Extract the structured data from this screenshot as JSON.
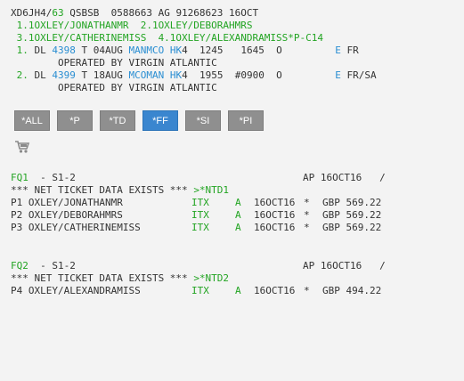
{
  "header": {
    "rec_prefix": "XD6JH4/",
    "rec_num": "63",
    "rec_rest": " QSBSB  0588663 AG 91268623 16OCT"
  },
  "names": {
    "line1": " 1.1OXLEY/JONATHANMR  2.1OXLEY/DEBORAHMRS",
    "line2": " 3.1OXLEY/CATHERINEMISS  4.1OXLEY/ALEXANDRAMISS*P-C14"
  },
  "segments": [
    {
      "num": " 1.",
      "airline": " DL ",
      "flight": "4398",
      "mid": " T 04AUG ",
      "route": "MANMCO",
      "status": " HK",
      "rest": "4  1245   1645  O         ",
      "e": "E",
      "tail": " FR",
      "operated": "        OPERATED BY VIRGIN ATLANTIC"
    },
    {
      "num": " 2.",
      "airline": " DL ",
      "flight": "4399",
      "mid": " T 18AUG ",
      "route": "MCOMAN",
      "status": " HK",
      "rest": "4  1955  #0900  O         ",
      "e": "E",
      "tail": " FR/SA",
      "operated": "        OPERATED BY VIRGIN ATLANTIC"
    }
  ],
  "toolbar": {
    "buttons": [
      {
        "label": "*ALL",
        "active": false
      },
      {
        "label": "*P",
        "active": false
      },
      {
        "label": "*TD",
        "active": false
      },
      {
        "label": "*FF",
        "active": true
      },
      {
        "label": "*SI",
        "active": false
      },
      {
        "label": "*PI",
        "active": false
      }
    ],
    "cart_icon": "shopping-cart-icon"
  },
  "fq1": {
    "id": "FQ1",
    "seg": "  - S1-2",
    "ap": "AP 16OCT16   /",
    "note": "*** NET TICKET DATA EXISTS *** ",
    "link": ">*NTD1",
    "rows": [
      {
        "pax": "P1 OXLEY/JONATHANMR",
        "ft": "ITX",
        "a": "A",
        "date": "16OCT16",
        "star": "*",
        "amt": "GBP 569.22"
      },
      {
        "pax": "P2 OXLEY/DEBORAHMRS",
        "ft": "ITX",
        "a": "A",
        "date": "16OCT16",
        "star": "*",
        "amt": "GBP 569.22"
      },
      {
        "pax": "P3 OXLEY/CATHERINEMISS",
        "ft": "ITX",
        "a": "A",
        "date": "16OCT16",
        "star": "*",
        "amt": "GBP 569.22"
      }
    ]
  },
  "fq2": {
    "id": "FQ2",
    "seg": "  - S1-2",
    "ap": "AP 16OCT16   /",
    "note": "*** NET TICKET DATA EXISTS *** ",
    "link": ">*NTD2",
    "rows": [
      {
        "pax": "P4 OXLEY/ALEXANDRAMISS",
        "ft": "ITX",
        "a": "A",
        "date": "16OCT16",
        "star": "*",
        "amt": "GBP 494.22"
      }
    ]
  },
  "colors": {
    "green": "#22a422",
    "blue": "#2a8ed2",
    "active_button": "#3a86cf",
    "button": "#8f8f8f"
  }
}
